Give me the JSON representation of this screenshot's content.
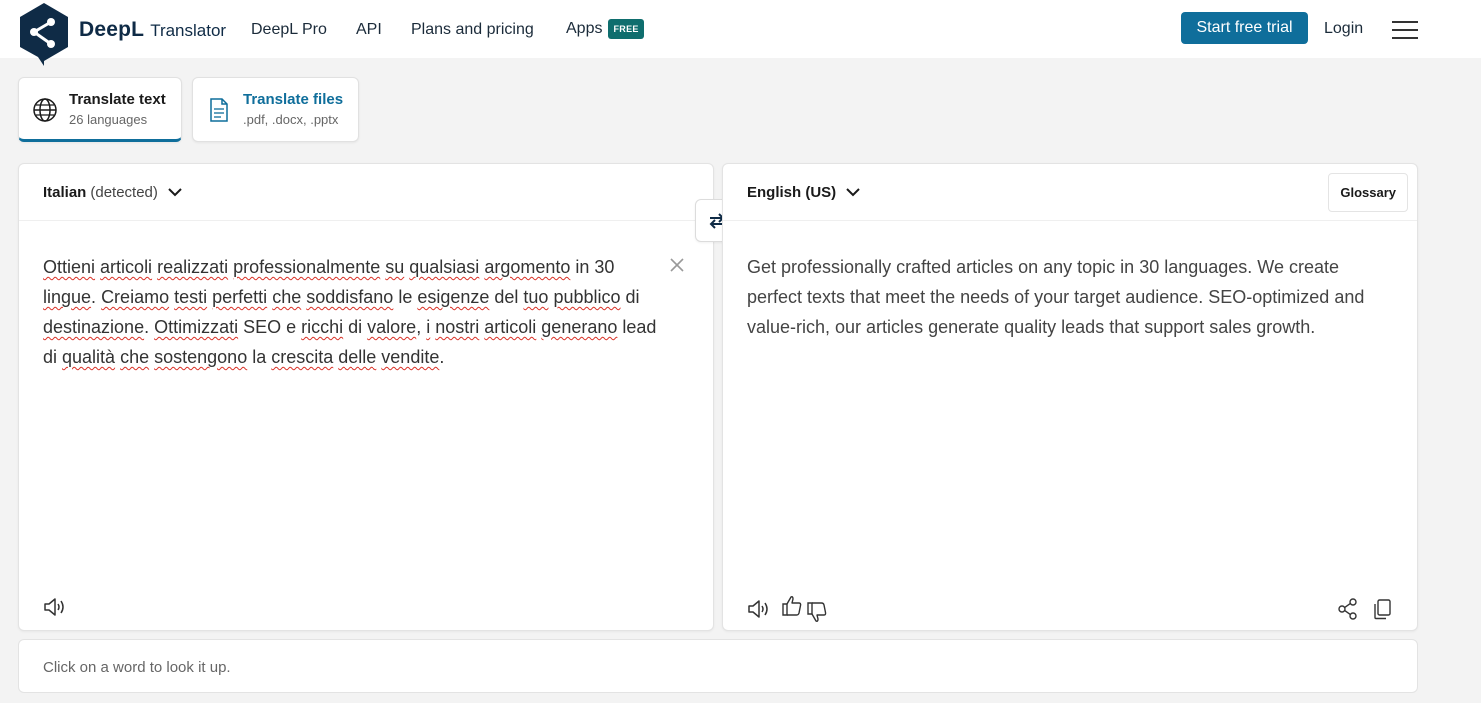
{
  "header": {
    "brand_name": "DeepL",
    "brand_sub": "Translator",
    "nav": {
      "pro": "DeepL Pro",
      "api": "API",
      "plans": "Plans and pricing",
      "apps": "Apps",
      "apps_badge": "FREE"
    },
    "trial_button": "Start free trial",
    "login": "Login"
  },
  "tabs": {
    "text": {
      "title": "Translate text",
      "sub": "26 languages"
    },
    "files": {
      "title": "Translate files",
      "sub": ".pdf, .docx, .pptx"
    }
  },
  "source": {
    "language": "Italian",
    "detected": "(detected)",
    "words": [
      {
        "t": "Ottieni",
        "sp": true
      },
      {
        "t": " "
      },
      {
        "t": "articoli",
        "sp": true
      },
      {
        "t": " "
      },
      {
        "t": "realizzati",
        "sp": true
      },
      {
        "t": " "
      },
      {
        "t": "professionalmente",
        "sp": true
      },
      {
        "t": " "
      },
      {
        "t": "su",
        "sp": true
      },
      {
        "t": " "
      },
      {
        "t": "qualsiasi",
        "sp": true
      },
      {
        "t": " "
      },
      {
        "t": "argomento",
        "sp": true
      },
      {
        "t": " in 30 "
      },
      {
        "t": "lingue",
        "sp": true
      },
      {
        "t": ". "
      },
      {
        "t": "Creiamo",
        "sp": true
      },
      {
        "t": " "
      },
      {
        "t": "testi",
        "sp": true
      },
      {
        "t": " "
      },
      {
        "t": "perfetti",
        "sp": true
      },
      {
        "t": " "
      },
      {
        "t": "che",
        "sp": true
      },
      {
        "t": " "
      },
      {
        "t": "soddisfano",
        "sp": true
      },
      {
        "t": " le "
      },
      {
        "t": "esigenze",
        "sp": true
      },
      {
        "t": " del "
      },
      {
        "t": "tuo",
        "sp": true
      },
      {
        "t": " "
      },
      {
        "t": "pubblico",
        "sp": true
      },
      {
        "t": " di "
      },
      {
        "t": "destinazione",
        "sp": true
      },
      {
        "t": ". "
      },
      {
        "t": "Ottimizzati",
        "sp": true
      },
      {
        "t": " SEO e "
      },
      {
        "t": "ricchi",
        "sp": true
      },
      {
        "t": " di "
      },
      {
        "t": "valore",
        "sp": true
      },
      {
        "t": ", "
      },
      {
        "t": "i",
        "sp": true
      },
      {
        "t": " "
      },
      {
        "t": "nostri",
        "sp": true
      },
      {
        "t": " "
      },
      {
        "t": "articoli",
        "sp": true
      },
      {
        "t": " "
      },
      {
        "t": "generano",
        "sp": true
      },
      {
        "t": " lead di "
      },
      {
        "t": "qualità",
        "sp": true
      },
      {
        "t": " "
      },
      {
        "t": "che",
        "sp": true
      },
      {
        "t": " "
      },
      {
        "t": "sostengono",
        "sp": true
      },
      {
        "t": " la "
      },
      {
        "t": "crescita",
        "sp": true
      },
      {
        "t": " "
      },
      {
        "t": "delle",
        "sp": true
      },
      {
        "t": " "
      },
      {
        "t": "vendite",
        "sp": true
      },
      {
        "t": "."
      }
    ]
  },
  "target": {
    "language": "English (US)",
    "glossary": "Glossary",
    "text": "Get professionally crafted articles on any topic in 30 languages. We create perfect texts that meet the needs of your target audience. SEO-optimized and value-rich, our articles generate quality leads that support sales growth."
  },
  "dictionary": {
    "hint": "Click on a word to look it up."
  },
  "colors": {
    "brand": "#0f2b46",
    "accent": "#0f6e9b",
    "free_badge": "#0f6e6e",
    "spell_underline": "#d93025"
  },
  "icons": [
    "deepl-logo-icon",
    "globe-icon",
    "document-icon",
    "chevron-down-icon",
    "swap-icon",
    "close-icon",
    "speaker-icon",
    "thumbs-up-icon",
    "thumbs-down-icon",
    "share-icon",
    "copy-icon",
    "menu-icon"
  ]
}
